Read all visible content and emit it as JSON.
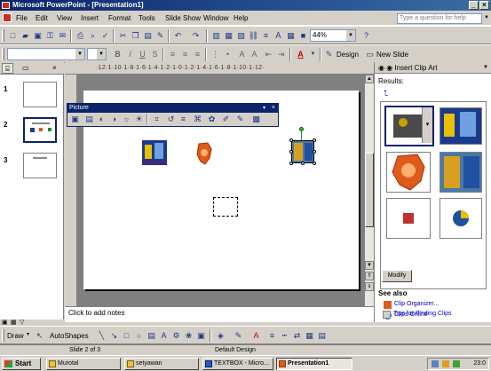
{
  "window": {
    "title": "Microsoft PowerPoint - [Presentation1]"
  },
  "menu": {
    "items": [
      "File",
      "Edit",
      "View",
      "Insert",
      "Format",
      "Tools",
      "Slide Show",
      "Window",
      "Help"
    ],
    "ask_placeholder": "Type a question for help"
  },
  "standard_toolbar": {
    "zoom": "44%",
    "design_label": "Design",
    "new_slide_label": "New Slide"
  },
  "outline_tabs": {
    "outline_icon": "outline-icon",
    "slides_icon": "slides-icon"
  },
  "slides": [
    {
      "number": "1"
    },
    {
      "number": "2"
    },
    {
      "number": "3"
    }
  ],
  "ruler": {
    "horizontal": "·12·1·10·1·8·1·6·1·4·1·2·1·0·1·2·1·4·1·6·1·8·1·10·1·12·"
  },
  "picture_toolbar": {
    "title": "Picture"
  },
  "notes": {
    "placeholder": "Click to add notes"
  },
  "task_pane": {
    "title": "Insert Clip Art",
    "results_label": "Results:",
    "modify_button": "Modify",
    "see_also_label": "See also",
    "links": [
      "Clip Organizer...",
      "Clips Online",
      "Tips for Finding Clips"
    ]
  },
  "drawing_toolbar": {
    "draw_label": "Draw",
    "autoshapes_label": "AutoShapes"
  },
  "status": {
    "slide_info": "Slide 2 of 3",
    "design": "Default Design"
  },
  "taskbar": {
    "start_label": "Start",
    "buttons": [
      "Murotal",
      "setyawan",
      "TEXTBOX - Micro...",
      "Presentation1"
    ],
    "clock": "23:0"
  },
  "colors": {
    "title_active": "#0a246a",
    "accent_orange": "#e05a1a",
    "face": "#d4d0c8"
  }
}
